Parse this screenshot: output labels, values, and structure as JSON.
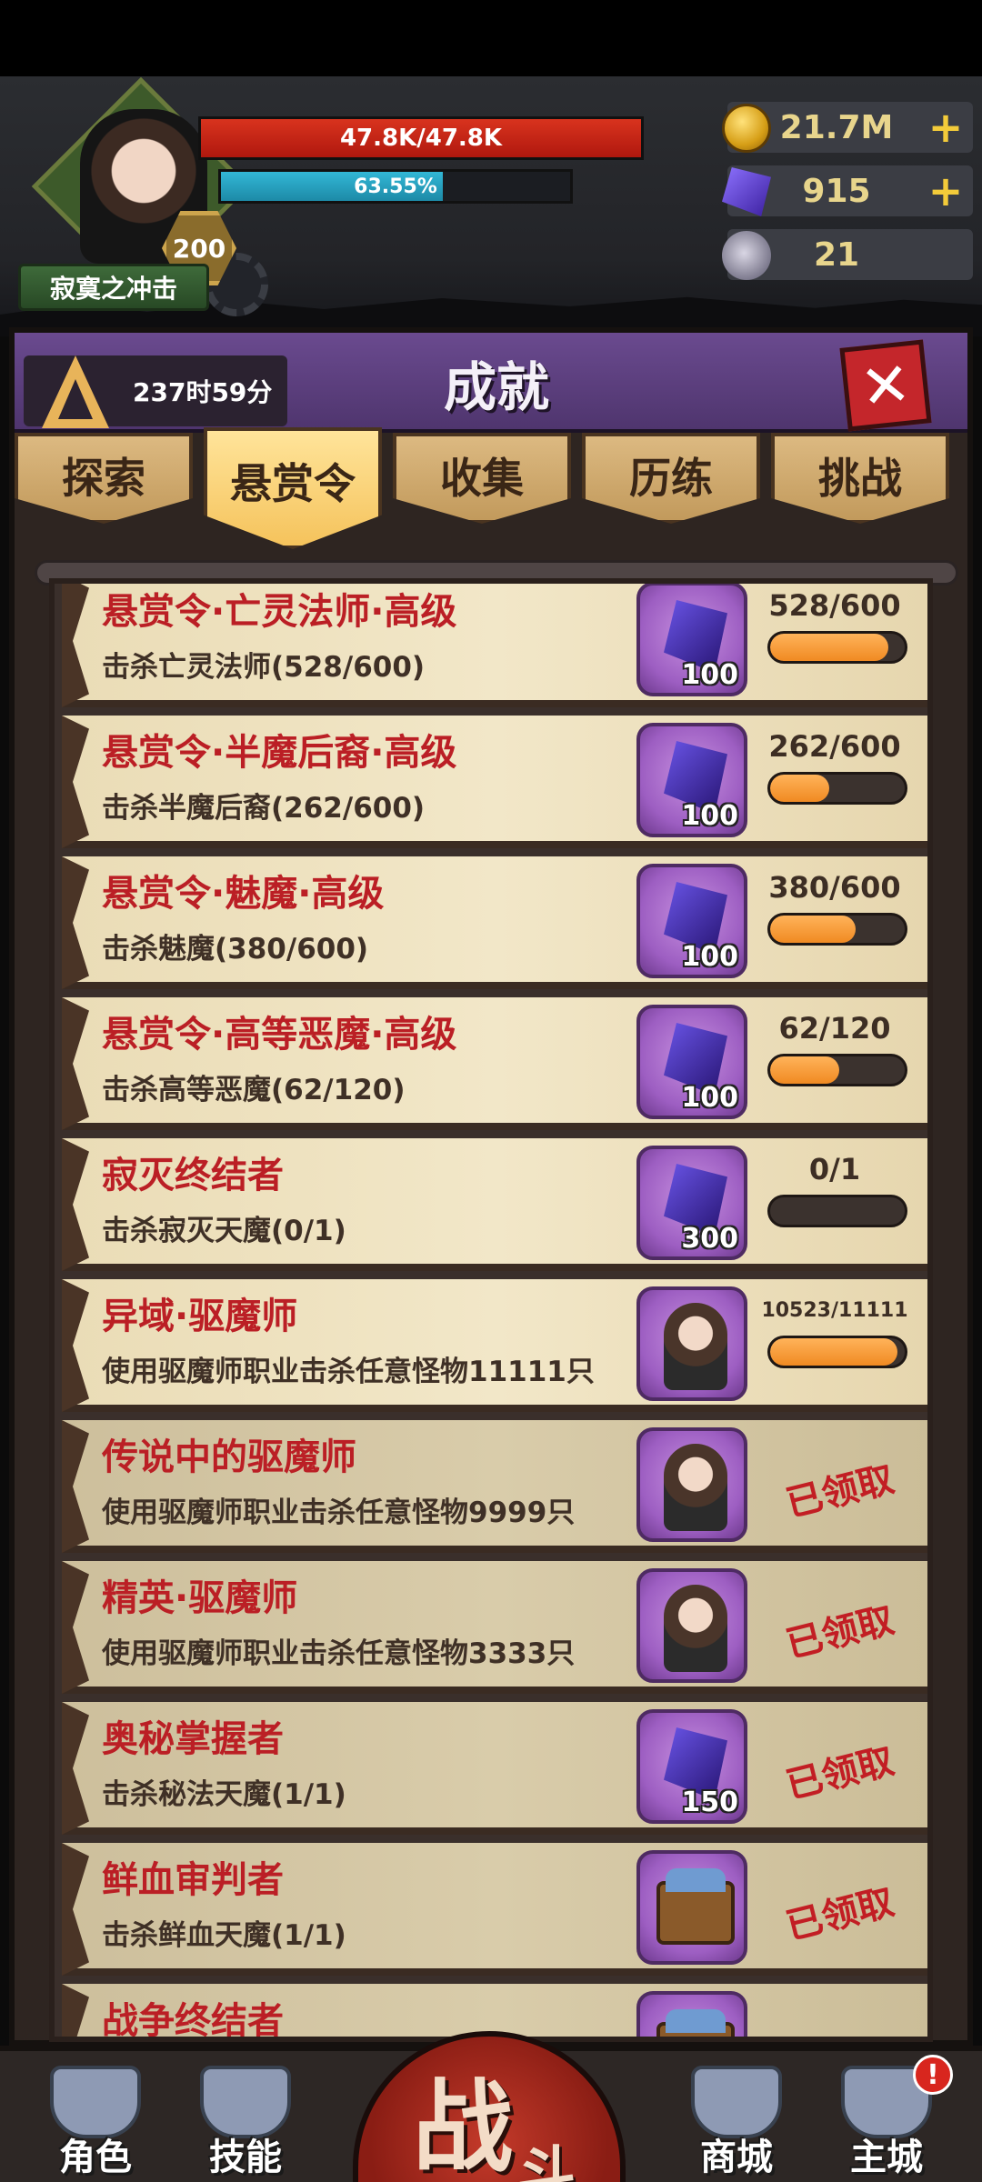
{
  "player": {
    "name": "寂寞之冲击",
    "level": "200",
    "hp_text": "47.8K/47.8K",
    "hp_fraction": 1.0,
    "exp_text": "63.55%",
    "exp_fraction": 0.6355
  },
  "currencies": [
    {
      "icon": "gold-coin-icon",
      "value": "21.7M",
      "has_plus": true
    },
    {
      "icon": "purple-gem-icon",
      "value": "915",
      "has_plus": true
    },
    {
      "icon": "ram-skull-icon",
      "value": "21",
      "has_plus": false
    }
  ],
  "panel": {
    "title": "成就",
    "timer": "237时59分",
    "close_label": "✕"
  },
  "tabs": [
    {
      "label": "探索",
      "active": false
    },
    {
      "label": "悬赏令",
      "active": true
    },
    {
      "label": "收集",
      "active": false
    },
    {
      "label": "历练",
      "active": false
    },
    {
      "label": "挑战",
      "active": false
    }
  ],
  "achievements": [
    {
      "title": "悬赏令·亡灵法师·高级",
      "desc": "击杀亡灵法师(528/600)",
      "reward_type": "gem",
      "reward_amount": "100",
      "progress_text": "528/600",
      "progress": 0.88,
      "claimed": false
    },
    {
      "title": "悬赏令·半魔后裔·高级",
      "desc": "击杀半魔后裔(262/600)",
      "reward_type": "gem",
      "reward_amount": "100",
      "progress_text": "262/600",
      "progress": 0.4367,
      "claimed": false
    },
    {
      "title": "悬赏令·魅魔·高级",
      "desc": "击杀魅魔(380/600)",
      "reward_type": "gem",
      "reward_amount": "100",
      "progress_text": "380/600",
      "progress": 0.6333,
      "claimed": false
    },
    {
      "title": "悬赏令·高等恶魔·高级",
      "desc": "击杀高等恶魔(62/120)",
      "reward_type": "gem",
      "reward_amount": "100",
      "progress_text": "62/120",
      "progress": 0.5167,
      "claimed": false
    },
    {
      "title": "寂灭终结者",
      "desc": "击杀寂灭天魔(0/1)",
      "reward_type": "gem",
      "reward_amount": "300",
      "progress_text": "0/1",
      "progress": 0.0,
      "claimed": false
    },
    {
      "title": "异域·驱魔师",
      "desc": "使用驱魔师职业击杀任意怪物11111只",
      "reward_type": "portrait",
      "reward_amount": "",
      "progress_text": "10523/11111",
      "progress": 0.947,
      "claimed": false
    },
    {
      "title": "传说中的驱魔师",
      "desc": "使用驱魔师职业击杀任意怪物9999只",
      "reward_type": "portrait",
      "reward_amount": "",
      "progress_text": "",
      "progress": 1.0,
      "claimed": true,
      "claimed_label": "已领取"
    },
    {
      "title": "精英·驱魔师",
      "desc": "使用驱魔师职业击杀任意怪物3333只",
      "reward_type": "portrait",
      "reward_amount": "",
      "progress_text": "",
      "progress": 1.0,
      "claimed": true,
      "claimed_label": "已领取"
    },
    {
      "title": "奥秘掌握者",
      "desc": "击杀秘法天魔(1/1)",
      "reward_type": "gem",
      "reward_amount": "150",
      "progress_text": "",
      "progress": 1.0,
      "claimed": true,
      "claimed_label": "已领取"
    },
    {
      "title": "鲜血审判者",
      "desc": "击杀鲜血天魔(1/1)",
      "reward_type": "chest",
      "reward_amount": "",
      "progress_text": "",
      "progress": 1.0,
      "claimed": true,
      "claimed_label": "已领取"
    },
    {
      "title": "战争终结者",
      "desc": "",
      "reward_type": "chest",
      "reward_amount": "",
      "progress_text": "",
      "progress": 1.0,
      "claimed": true,
      "claimed_label": ""
    }
  ],
  "bottom_nav": [
    {
      "label": "角色",
      "icon": "character-icon",
      "badge": ""
    },
    {
      "label": "技能",
      "icon": "skill-icon",
      "badge": ""
    },
    {
      "label": "商城",
      "icon": "shop-icon",
      "badge": ""
    },
    {
      "label": "主城",
      "icon": "castle-icon",
      "badge": "!"
    }
  ],
  "battle": {
    "main": "战",
    "sub": "斗"
  }
}
